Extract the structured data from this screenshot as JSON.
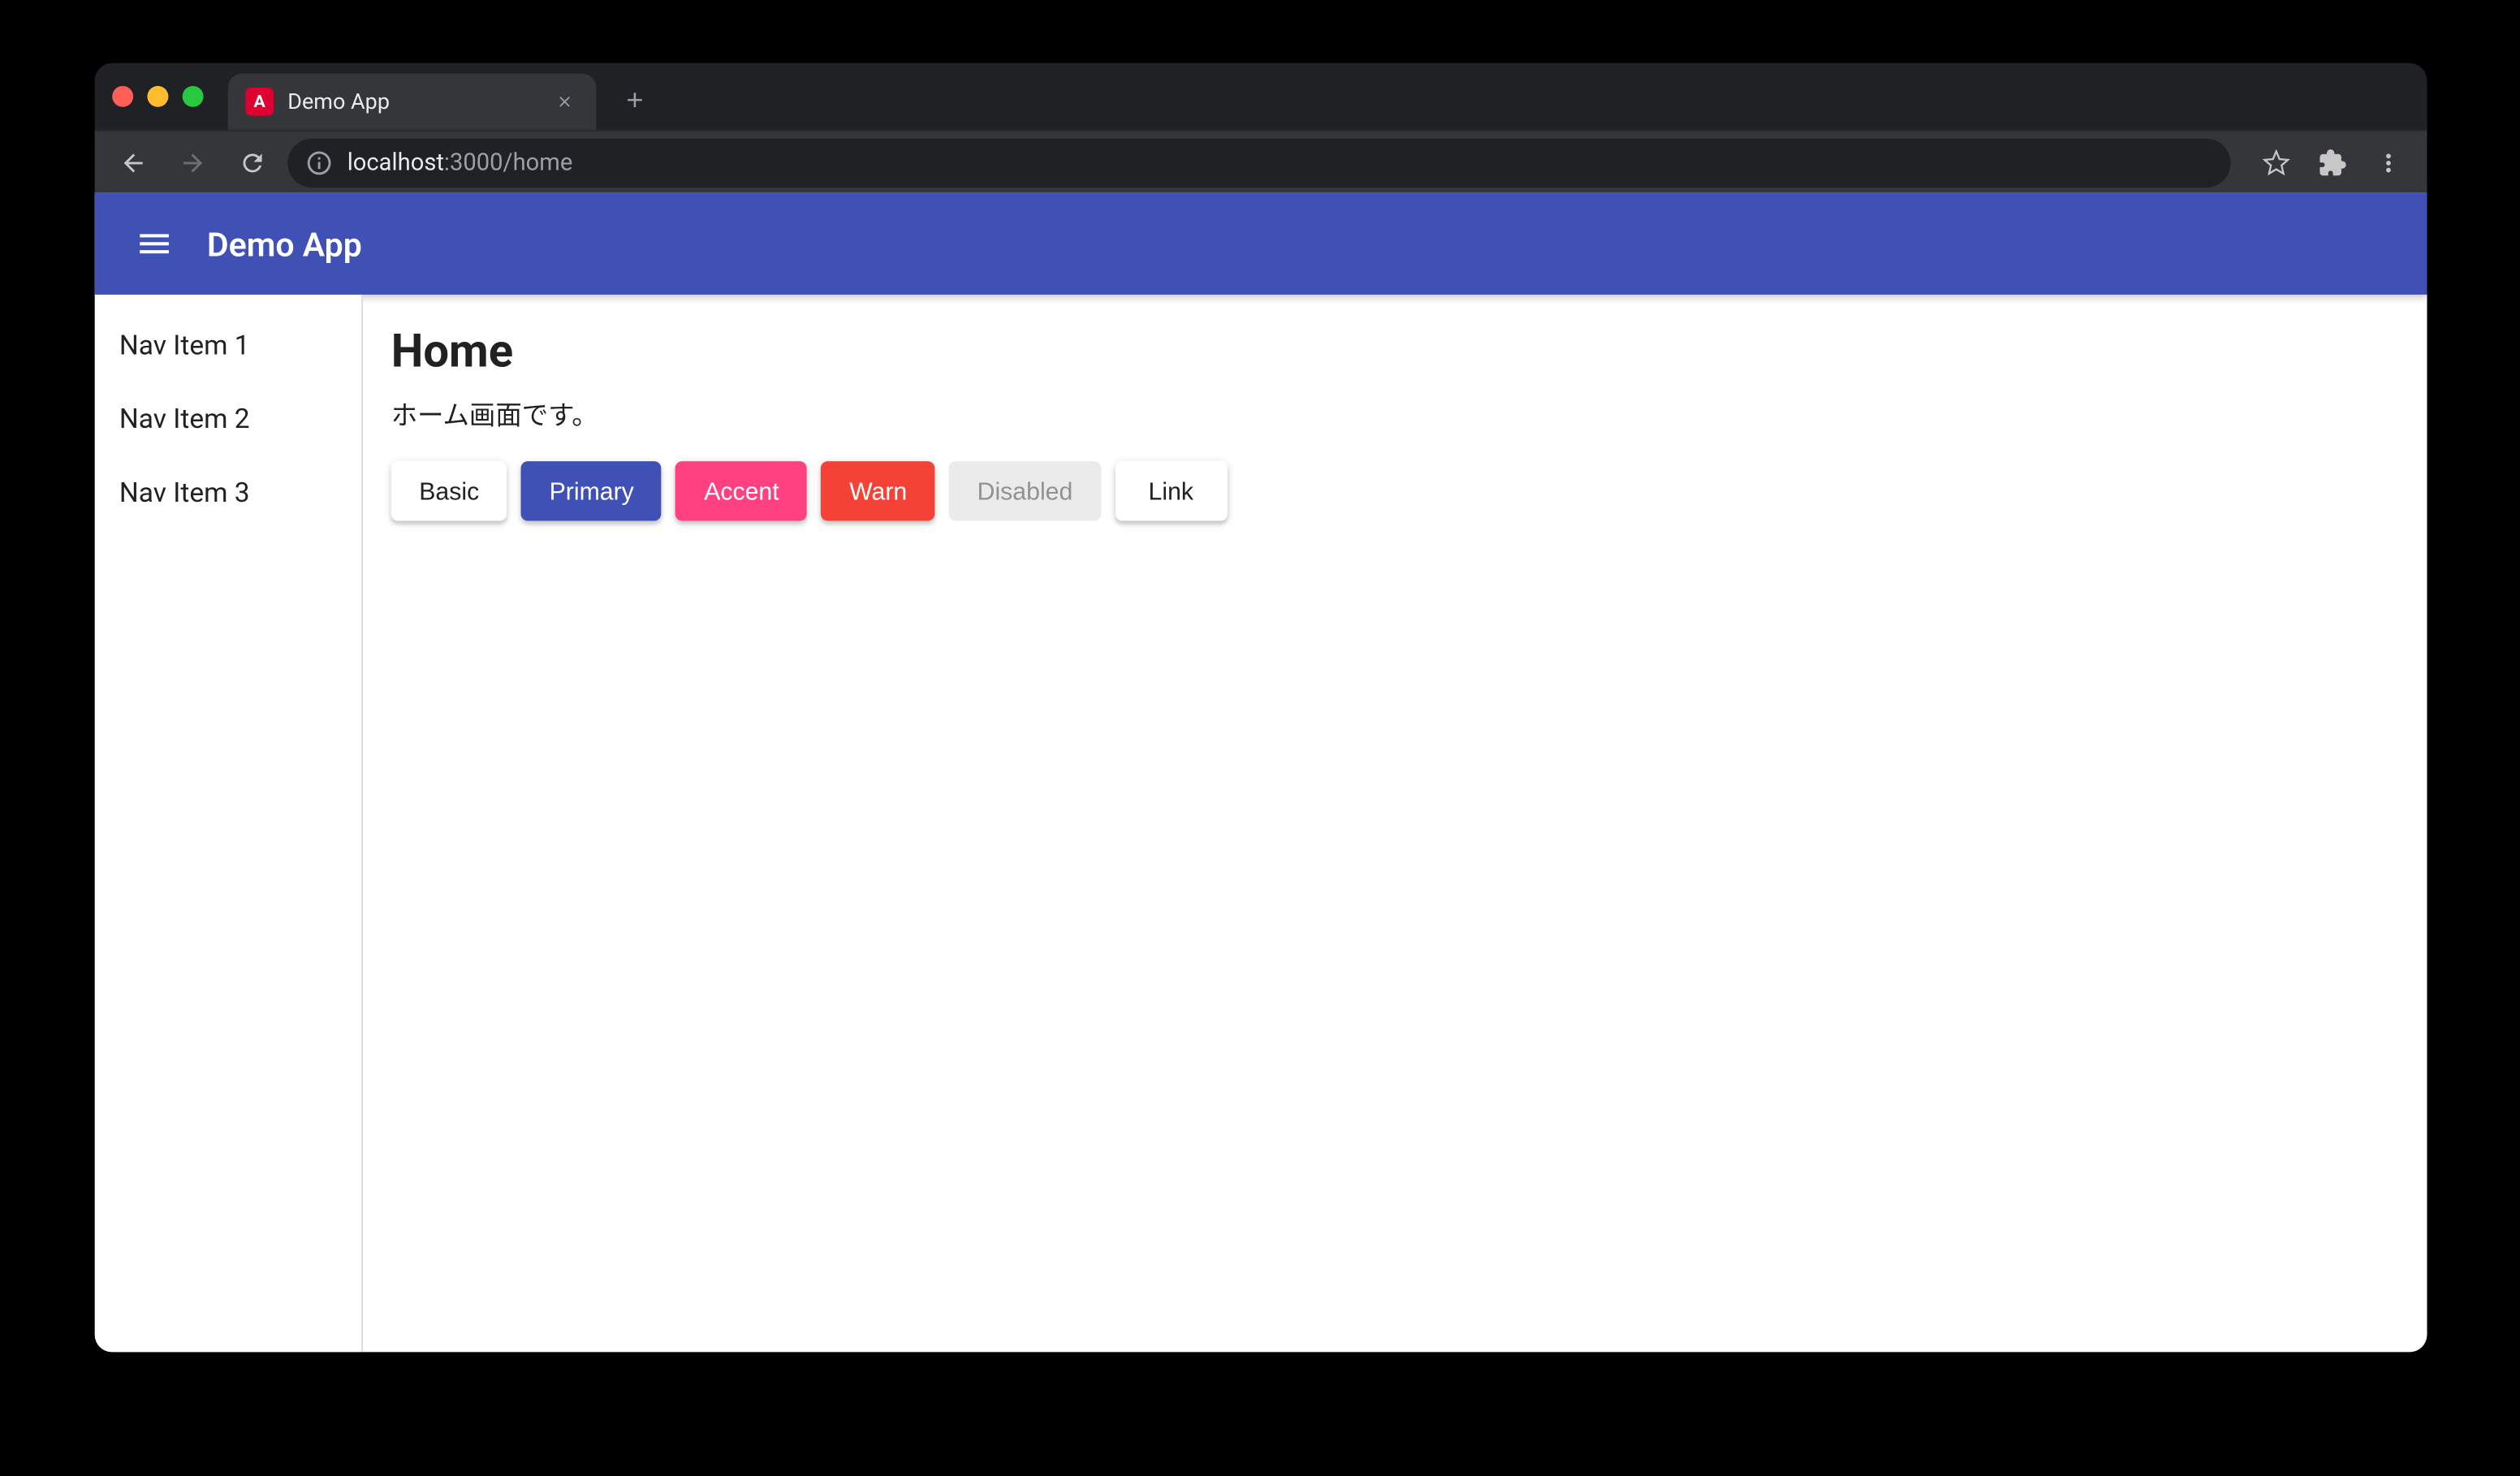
{
  "browser": {
    "tab": {
      "title": "Demo App",
      "favicon_letter": "A"
    },
    "url": {
      "host": "localhost",
      "port_path": ":3000/home"
    }
  },
  "app": {
    "toolbar": {
      "title": "Demo App"
    },
    "sidenav": {
      "items": [
        {
          "label": "Nav Item 1"
        },
        {
          "label": "Nav Item 2"
        },
        {
          "label": "Nav Item 3"
        }
      ]
    },
    "content": {
      "heading": "Home",
      "paragraph": "ホーム画面です。",
      "buttons": {
        "basic": "Basic",
        "primary": "Primary",
        "accent": "Accent",
        "warn": "Warn",
        "disabled": "Disabled",
        "link": "Link"
      }
    }
  },
  "colors": {
    "primary": "#3f51b5",
    "accent": "#ff4081",
    "warn": "#f44336"
  }
}
